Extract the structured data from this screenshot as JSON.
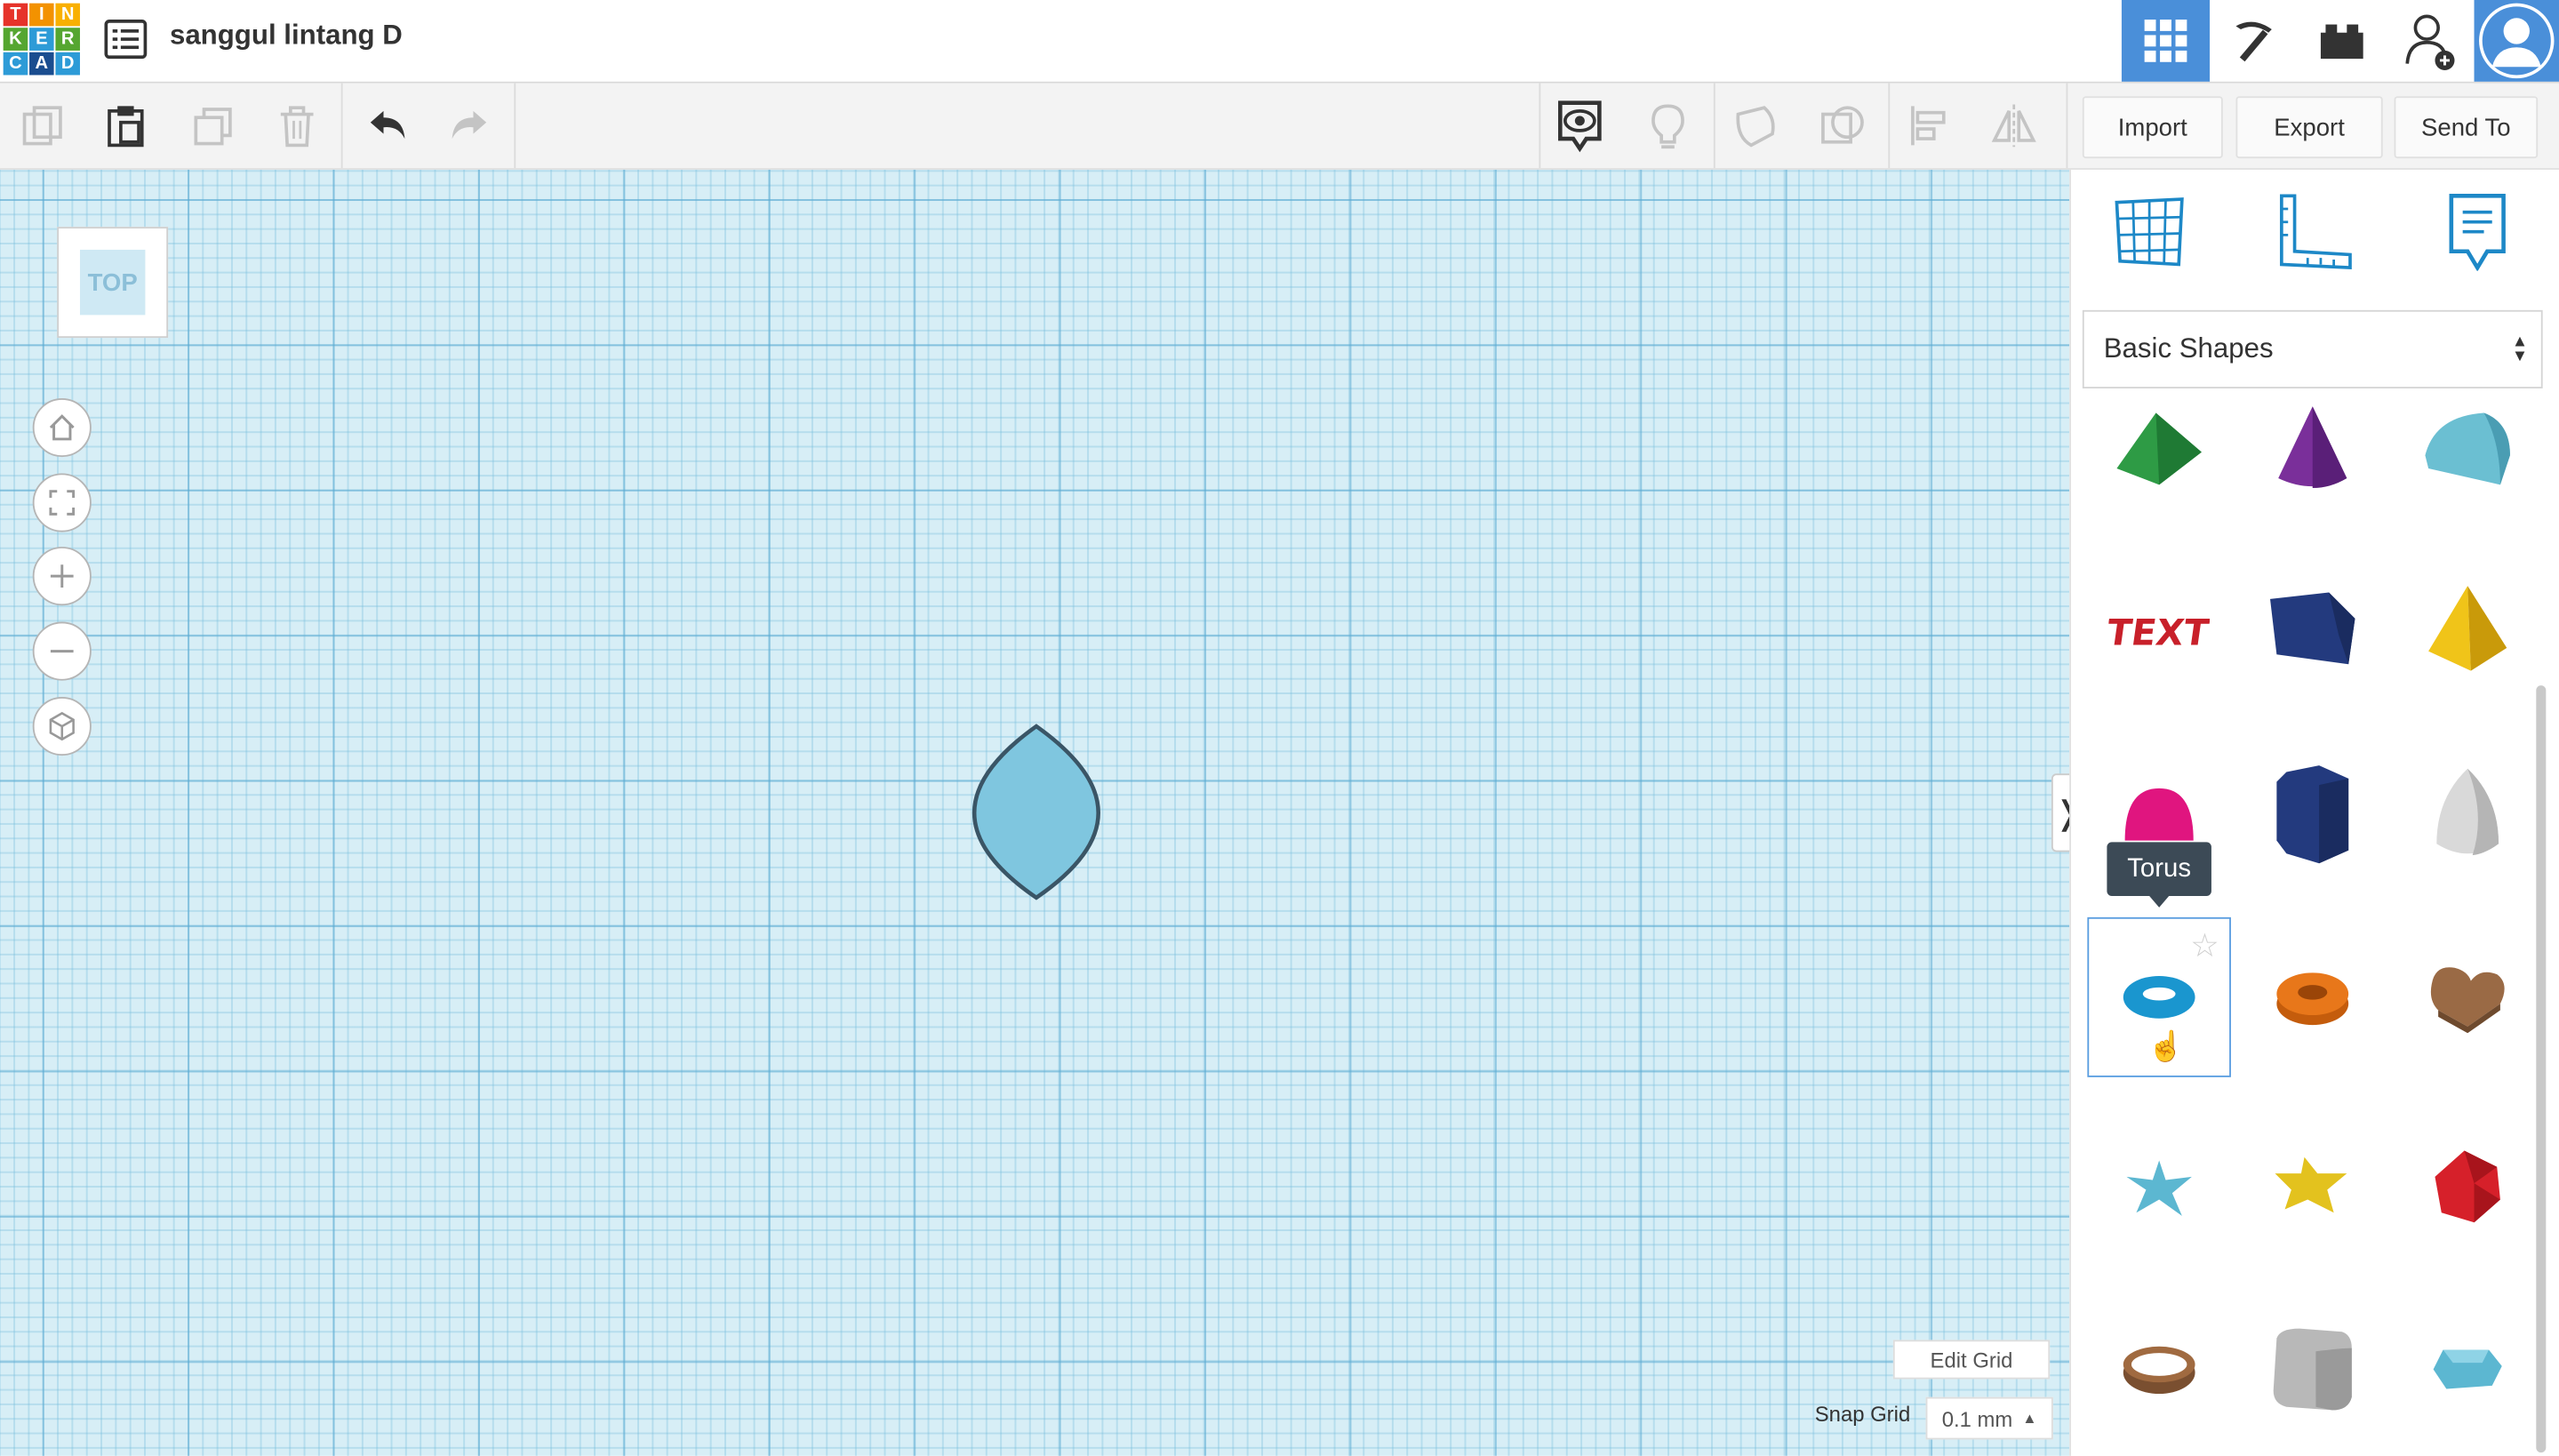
{
  "app": {
    "logo_letters": [
      "T",
      "I",
      "N",
      "K",
      "E",
      "R",
      "C",
      "A",
      "D"
    ],
    "logo_colors": [
      "#e6332a",
      "#f39200",
      "#f9b000",
      "#55a630",
      "#2d9bd7",
      "#55a630",
      "#2d9bd7",
      "#1a4d8f",
      "#2d9bd7"
    ],
    "project_title": "sanggul lintang D"
  },
  "toolbar": {
    "import_label": "Import",
    "export_label": "Export",
    "send_to_label": "Send To"
  },
  "viewcube": {
    "face_label": "TOP"
  },
  "grid": {
    "edit_grid_label": "Edit Grid",
    "snap_grid_label": "Snap Grid",
    "snap_grid_value": "0.1 mm"
  },
  "panel": {
    "library_selected": "Basic Shapes",
    "tooltip": "Torus"
  },
  "colors": {
    "workplane": "#d7eef6",
    "accent": "#4a8fd9",
    "shape_fill": "#7fc6df",
    "shape_stroke": "#3a5566"
  }
}
